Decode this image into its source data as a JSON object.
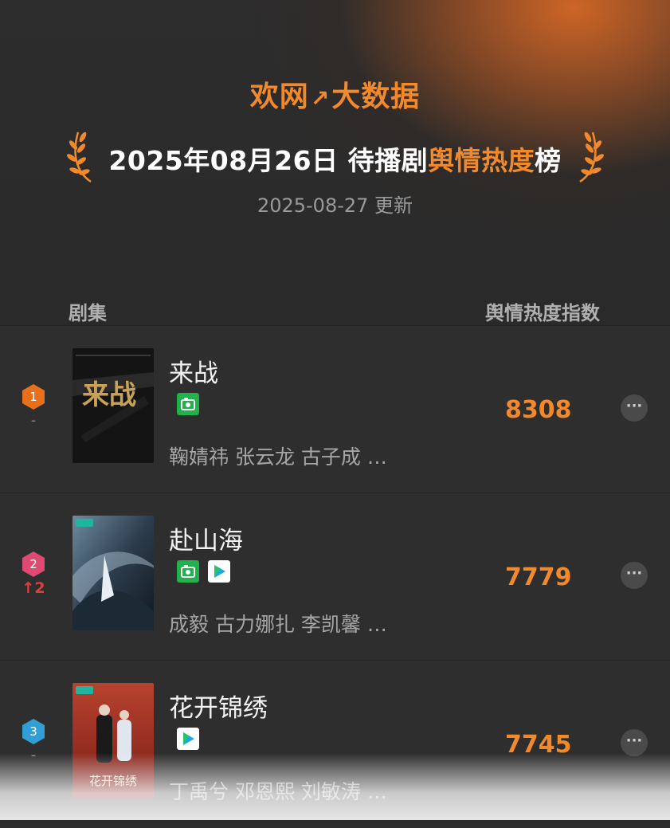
{
  "header": {
    "brand": "欢网",
    "brand_suffix": "大数据",
    "title_prefix": "2025年08月26日 待播剧",
    "title_highlight": "舆情热度",
    "title_suffix": "榜",
    "updated": "2025-08-27 更新"
  },
  "columns": {
    "left": "剧集",
    "right": "舆情热度指数"
  },
  "colors": {
    "accent": "#f28a2c",
    "rank1": "#e8701c",
    "rank2": "#e04a72",
    "rank3": "#2f9fd6",
    "rank_up": "#e23d3d"
  },
  "rows": [
    {
      "rank": "1",
      "change": "-",
      "title": "来战",
      "platforms": [
        "iqiyi-icon"
      ],
      "cast": "鞠婧祎 张云龙 古子成 …",
      "score": "8308",
      "more": "···",
      "poster_text": "来战"
    },
    {
      "rank": "2",
      "change": "↑2",
      "title": "赴山海",
      "platforms": [
        "iqiyi-icon",
        "tencent-video-icon"
      ],
      "cast": "成毅 古力娜扎 李凯馨 …",
      "score": "7779",
      "more": "···",
      "poster_text": ""
    },
    {
      "rank": "3",
      "change": "-",
      "title": "花开锦绣",
      "platforms": [
        "tencent-video-icon"
      ],
      "cast": "丁禹兮 邓恩熙 刘敏涛 …",
      "score": "7745",
      "more": "···",
      "poster_text": "花开锦绣"
    }
  ]
}
